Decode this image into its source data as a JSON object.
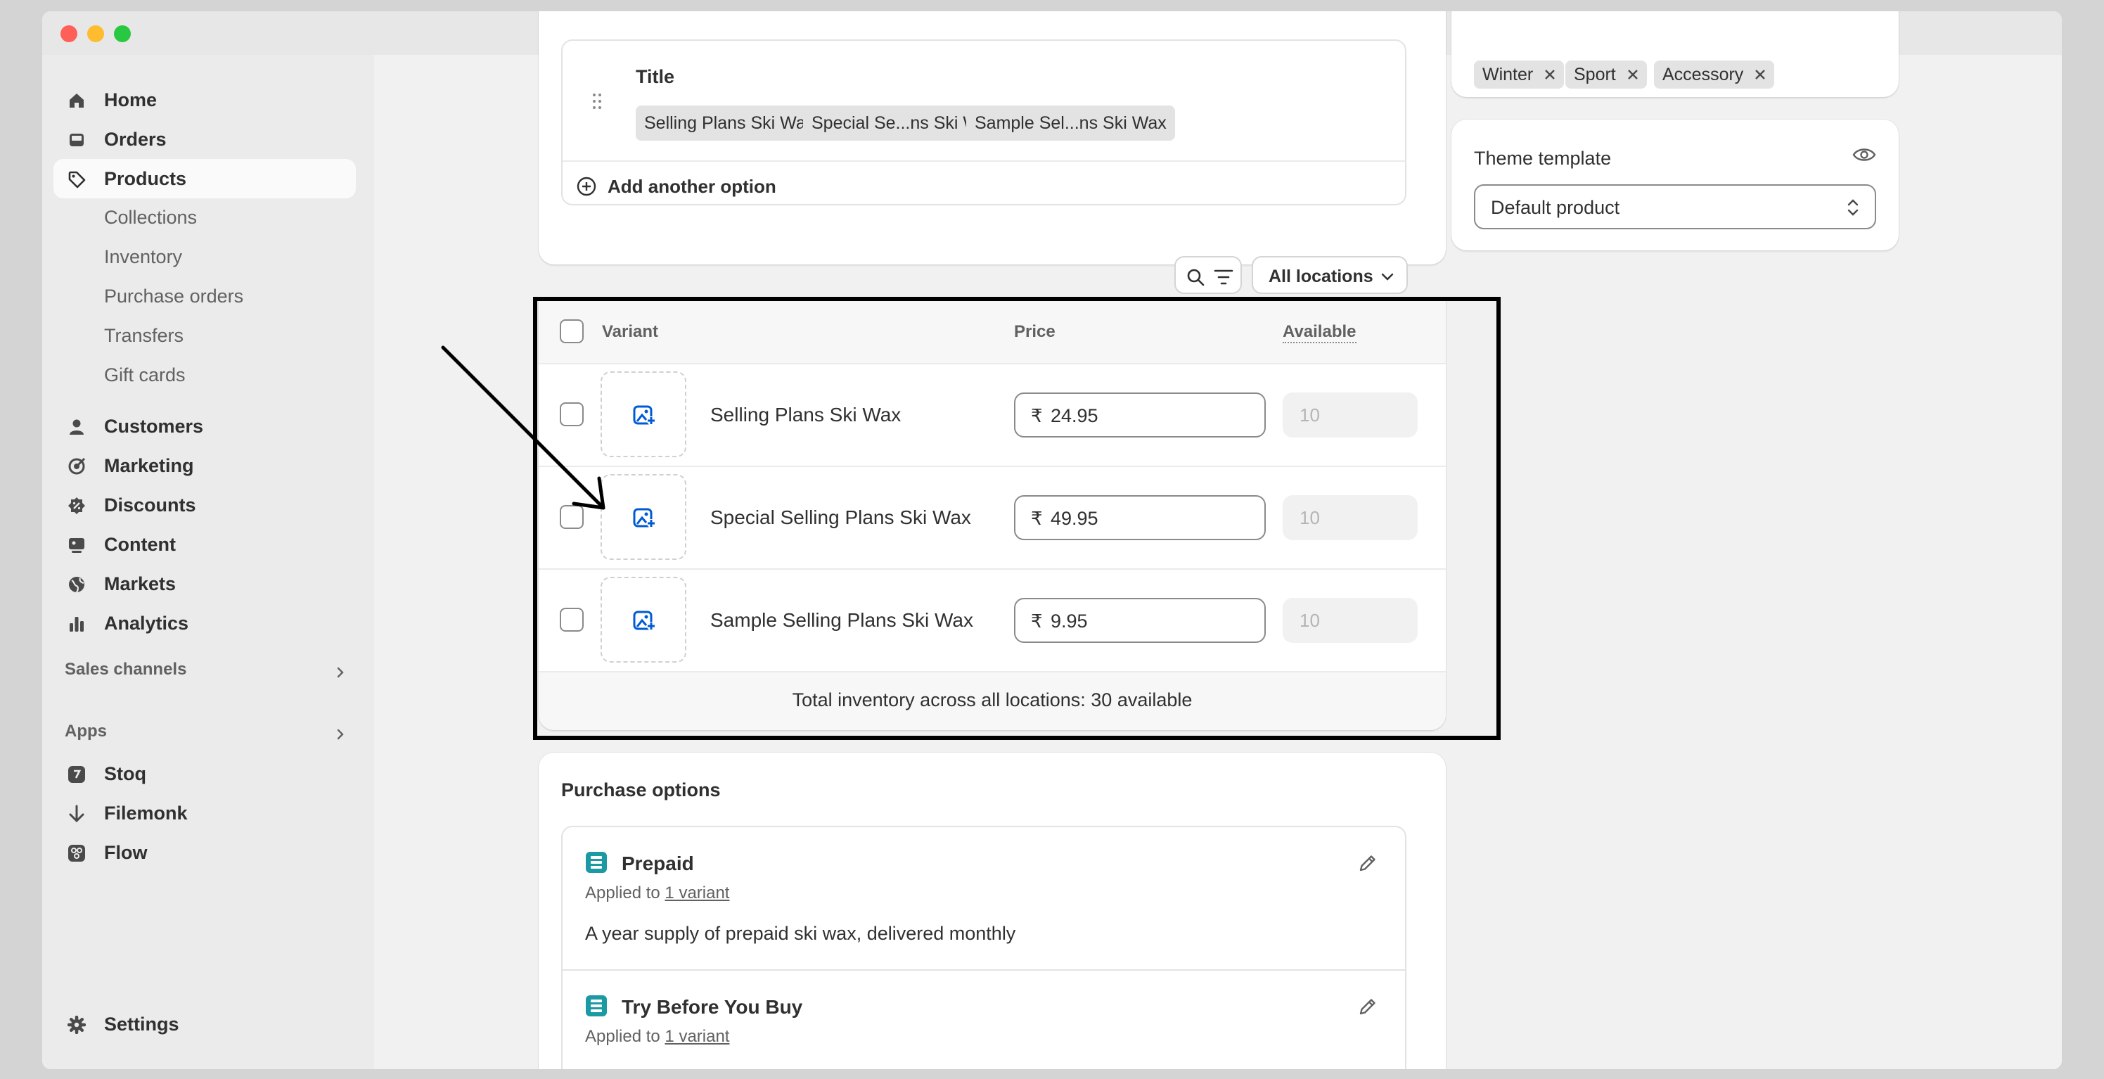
{
  "sidebar": {
    "nav": [
      {
        "label": "Home",
        "icon": "home-icon"
      },
      {
        "label": "Orders",
        "icon": "inbox-icon"
      },
      {
        "label": "Products",
        "icon": "tag-icon"
      },
      {
        "label": "Customers",
        "icon": "person-icon"
      },
      {
        "label": "Marketing",
        "icon": "target-icon"
      },
      {
        "label": "Discounts",
        "icon": "discount-icon"
      },
      {
        "label": "Content",
        "icon": "content-icon"
      },
      {
        "label": "Markets",
        "icon": "globe-icon"
      },
      {
        "label": "Analytics",
        "icon": "bar-chart-icon"
      }
    ],
    "product_subitems": [
      "Collections",
      "Inventory",
      "Purchase orders",
      "Transfers",
      "Gift cards"
    ],
    "sales_channels_label": "Sales channels",
    "apps_label": "Apps",
    "apps": [
      {
        "label": "Stoq",
        "icon": "stoq-icon"
      },
      {
        "label": "Filemonk",
        "icon": "arrow-down-icon"
      },
      {
        "label": "Flow",
        "icon": "flow-icon"
      }
    ],
    "settings_label": "Settings"
  },
  "options": {
    "option_name": "Title",
    "values": [
      "Selling Plans Ski Wax",
      "Special Se...ns Ski Wax",
      "Sample Sel...ns Ski Wax"
    ],
    "add_option_label": "Add another option"
  },
  "variants_toolbar": {
    "location_filter": "All locations"
  },
  "variants_table": {
    "headers": {
      "variant": "Variant",
      "price": "Price",
      "available": "Available"
    },
    "currency_symbol": "₹",
    "rows": [
      {
        "name": "Selling Plans Ski Wax",
        "price": "24.95",
        "available": "10"
      },
      {
        "name": "Special Selling Plans Ski Wax",
        "price": "49.95",
        "available": "10"
      },
      {
        "name": "Sample Selling Plans Ski Wax",
        "price": "9.95",
        "available": "10"
      }
    ],
    "total_label": "Total inventory across all locations: 30 available"
  },
  "purchase_options": {
    "title": "Purchase options",
    "applied_prefix": "Applied to",
    "plans": [
      {
        "name": "Prepaid",
        "applied_link": "1 variant",
        "description": "A year supply of prepaid ski wax, delivered monthly"
      },
      {
        "name": "Try Before You Buy",
        "applied_link": "1 variant"
      }
    ]
  },
  "tags": [
    "Winter",
    "Sport",
    "Accessory"
  ],
  "theme_template": {
    "label": "Theme template",
    "selected": "Default product"
  },
  "colors": {
    "accent_blue": "#005bd3",
    "plan_teal": "#1b9aa3",
    "highlight_border": "#000000"
  }
}
